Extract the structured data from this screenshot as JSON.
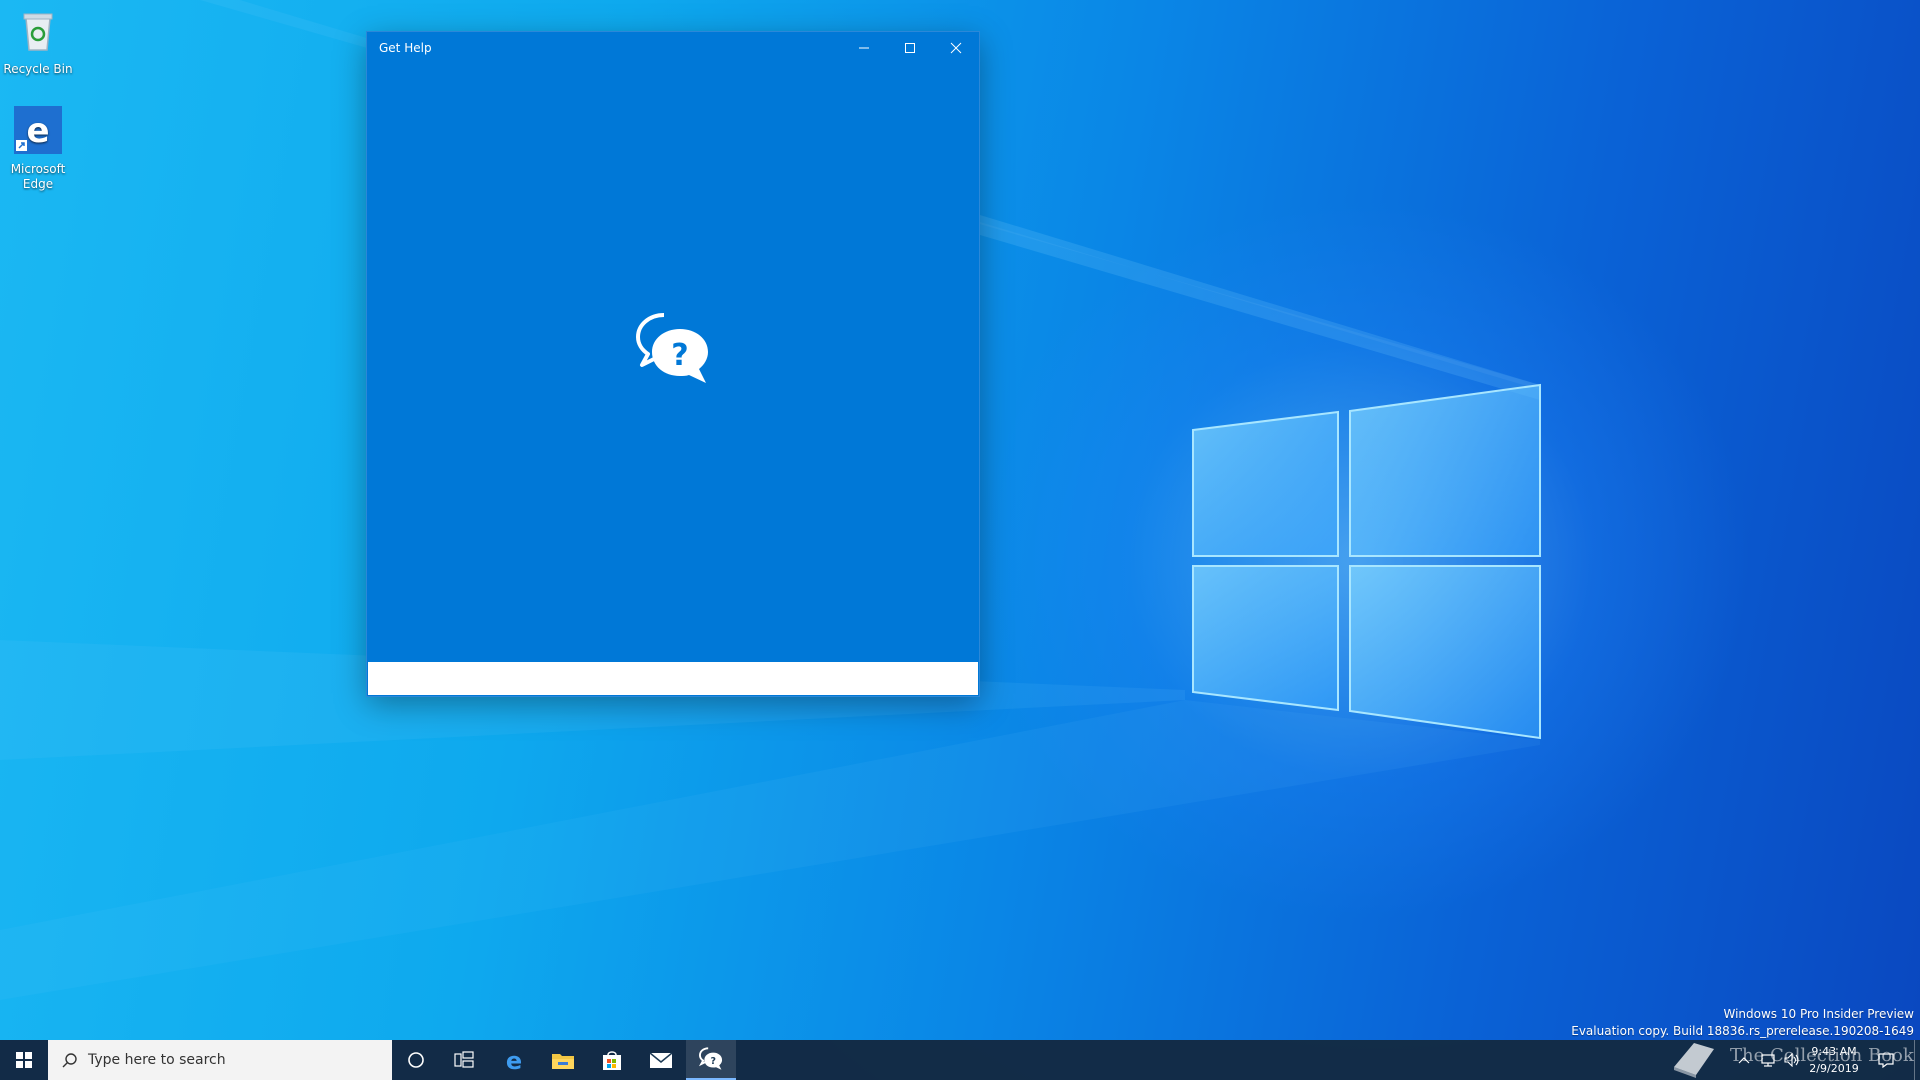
{
  "desktop": {
    "icons": [
      {
        "label": "Recycle Bin"
      },
      {
        "label": "Microsoft Edge"
      }
    ]
  },
  "window": {
    "title": "Get Help",
    "accent_color": "#0078d7"
  },
  "taskbar": {
    "search_placeholder": "Type here to search",
    "pinned": [
      "start-icon",
      "cortana-icon",
      "task-view-icon",
      "edge-icon",
      "file-explorer-icon",
      "store-icon",
      "mail-icon",
      "get-help-icon"
    ],
    "clock": {
      "time": "9:43 AM",
      "date": "2/9/2019"
    }
  },
  "watermark": {
    "line1": "Windows 10 Pro Insider Preview",
    "line2": "Evaluation copy. Build 18836.rs_prerelease.190208-1649",
    "brand": "The Collection Book"
  }
}
